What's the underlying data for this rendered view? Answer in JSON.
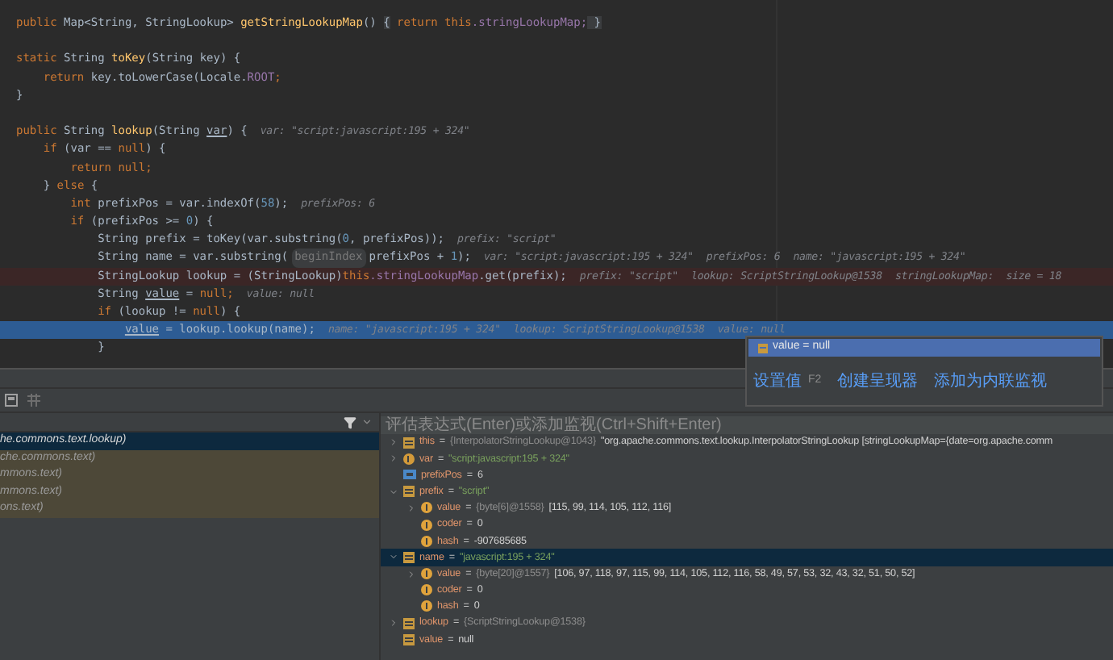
{
  "editor": {
    "lines": [
      {
        "segments": [
          {
            "kind": "kw",
            "text": "public "
          },
          {
            "kind": "plain",
            "text": "Map<String, StringLookup> "
          },
          {
            "kind": "method",
            "text": "getStringLookupMap"
          },
          {
            "kind": "plain",
            "text": "() "
          },
          {
            "kind": "fold",
            "text": "{"
          },
          {
            "kind": "kw",
            "text": " return this"
          },
          {
            "kind": "field",
            "text": ".stringLookupMap;"
          },
          {
            "kind": "fold",
            "text": " }"
          }
        ]
      },
      {
        "kind": "blank"
      },
      {
        "segments": [
          {
            "kind": "kw",
            "text": "static "
          },
          {
            "kind": "plain",
            "text": "String "
          },
          {
            "kind": "method",
            "text": "toKey"
          },
          {
            "kind": "plain",
            "text": "(String key) {"
          }
        ]
      },
      {
        "segments": [
          {
            "kind": "kw",
            "text": "    return "
          },
          {
            "kind": "plain",
            "text": "key.toLowerCase(Locale."
          },
          {
            "kind": "field",
            "text": "ROOT"
          },
          {
            "kind": "kw",
            "text": ";"
          }
        ]
      },
      {
        "segments": [
          {
            "kind": "plain",
            "text": "}"
          }
        ]
      },
      {
        "kind": "blank"
      },
      {
        "segments": [
          {
            "kind": "kw",
            "text": "public "
          },
          {
            "kind": "plain",
            "text": "String "
          },
          {
            "kind": "method",
            "text": "lookup"
          },
          {
            "kind": "plain",
            "text": "(String "
          },
          {
            "kind": "ul",
            "text": "var"
          },
          {
            "kind": "plain",
            "text": ") {"
          },
          {
            "kind": "hint",
            "text": "var: \"script:javascript:195 + 324\""
          }
        ]
      },
      {
        "segments": [
          {
            "kind": "kw",
            "text": "    if "
          },
          {
            "kind": "plain",
            "text": "(var == "
          },
          {
            "kind": "kw",
            "text": "null"
          },
          {
            "kind": "plain",
            "text": ") {"
          }
        ]
      },
      {
        "segments": [
          {
            "kind": "kw",
            "text": "        return null;"
          }
        ]
      },
      {
        "segments": [
          {
            "kind": "plain",
            "text": "    } "
          },
          {
            "kind": "kw",
            "text": "else "
          },
          {
            "kind": "plain",
            "text": "{"
          }
        ]
      },
      {
        "segments": [
          {
            "kind": "kw",
            "text": "        int "
          },
          {
            "kind": "plain",
            "text": "prefixPos = var.indexOf("
          },
          {
            "kind": "num",
            "text": "58"
          },
          {
            "kind": "plain",
            "text": ");"
          },
          {
            "kind": "hint",
            "text": "prefixPos: 6"
          }
        ]
      },
      {
        "segments": [
          {
            "kind": "kw",
            "text": "        if "
          },
          {
            "kind": "plain",
            "text": "(prefixPos >= "
          },
          {
            "kind": "num",
            "text": "0"
          },
          {
            "kind": "plain",
            "text": ") {"
          }
        ]
      },
      {
        "segments": [
          {
            "kind": "plain",
            "text": "            String prefix = toKey(var.substring("
          },
          {
            "kind": "num",
            "text": "0"
          },
          {
            "kind": "plain",
            "text": ", prefixPos));"
          },
          {
            "kind": "hint",
            "text": "prefix: \"script\""
          }
        ]
      },
      {
        "segments": [
          {
            "kind": "plain",
            "text": "            String name = var.substring("
          },
          {
            "kind": "param",
            "text": "beginIndex"
          },
          {
            "kind": "plain",
            "text": "prefixPos + "
          },
          {
            "kind": "num",
            "text": "1"
          },
          {
            "kind": "plain",
            "text": ");"
          },
          {
            "kind": "hint",
            "text": "var: \"script:javascript:195 + 324\""
          },
          {
            "kind": "hint",
            "text": "prefixPos: 6"
          },
          {
            "kind": "hint",
            "text": "name: \"javascript:195 + 324\""
          }
        ]
      },
      {
        "kind": "breakpoint",
        "segments": [
          {
            "kind": "plain",
            "text": "            StringLookup lookup = (StringLookup)"
          },
          {
            "kind": "kw",
            "text": "this"
          },
          {
            "kind": "field",
            "text": ".stringLookupMap"
          },
          {
            "kind": "plain",
            "text": ".get(prefix);"
          },
          {
            "kind": "hint",
            "text": "prefix: \"script\""
          },
          {
            "kind": "hint",
            "text": "lookup: ScriptStringLookup@1538"
          },
          {
            "kind": "hint",
            "text": "stringLookupMap:  size = 18"
          }
        ]
      },
      {
        "segments": [
          {
            "kind": "plain",
            "text": "            String "
          },
          {
            "kind": "ul",
            "text": "value"
          },
          {
            "kind": "plain",
            "text": " = "
          },
          {
            "kind": "kw",
            "text": "null;"
          },
          {
            "kind": "hint",
            "text": "value: null"
          }
        ]
      },
      {
        "segments": [
          {
            "kind": "kw",
            "text": "            if "
          },
          {
            "kind": "plain",
            "text": "(lookup != "
          },
          {
            "kind": "kw",
            "text": "null"
          },
          {
            "kind": "plain",
            "text": ") {"
          }
        ]
      },
      {
        "kind": "current",
        "segments": [
          {
            "kind": "ul",
            "text": "                value"
          },
          {
            "kind": "plain",
            "text": " = lookup.lookup(name);"
          },
          {
            "kind": "hint",
            "text": "name: \"javascript:195 + 324\""
          },
          {
            "kind": "hint",
            "text": "lookup: ScriptStringLookup@1538"
          },
          {
            "kind": "hint",
            "text": "value: null"
          }
        ]
      },
      {
        "segments": [
          {
            "kind": "plain",
            "text": "            }"
          }
        ]
      }
    ]
  },
  "popup": {
    "row": "value = null",
    "actions": [
      {
        "label": "设置值",
        "shortcut": "F2"
      },
      {
        "label": "创建呈现器"
      },
      {
        "label": "添加为内联监视"
      }
    ]
  },
  "frames": [
    {
      "text": "he.commons.text.lookup)",
      "selected": true,
      "library": false
    },
    {
      "text": "che.commons.text)",
      "selected": false,
      "library": true
    },
    {
      "text": "mmons.text)",
      "selected": false,
      "library": true
    },
    {
      "text": "mmons.text)",
      "selected": false,
      "library": true
    },
    {
      "text": "ons.text)",
      "selected": false,
      "library": true
    }
  ],
  "evaluate": {
    "placeholder": "评估表达式(Enter)或添加监视(Ctrl+Shift+Enter)"
  },
  "variables": [
    {
      "kind": "field",
      "name": "this",
      "op": "=",
      "type": "{InterpolatorStringLookup@1043}",
      "value": "\"org.apache.commons.text.lookup.InterpolatorStringLookup [stringLookupMap={date=org.apache.comm",
      "expanded": false,
      "selected": false
    },
    {
      "kind": "param",
      "name": "var",
      "op": "=",
      "string": "\"script:javascript:195 + 324\"",
      "expanded": false,
      "selected": false
    },
    {
      "kind": "primitive",
      "name": "prefixPos",
      "op": "=",
      "value": "6",
      "selected": false
    },
    {
      "kind": "field",
      "name": "prefix",
      "op": "=",
      "string": "\"script\"",
      "expanded": true,
      "selected": false,
      "children": [
        {
          "kind": "final",
          "name": "value",
          "op": "=",
          "type": "{byte[6]@1558}",
          "value": "[115, 99, 114, 105, 112, 116]",
          "expanded": false,
          "selected": false
        },
        {
          "kind": "final",
          "name": "coder",
          "op": "=",
          "value": "0",
          "selected": false
        },
        {
          "kind": "final",
          "name": "hash",
          "op": "=",
          "value": "-907685685",
          "selected": false
        }
      ]
    },
    {
      "kind": "field",
      "name": "name",
      "op": "=",
      "string": "\"javascript:195 + 324\"",
      "expanded": true,
      "selected": true,
      "children": [
        {
          "kind": "final",
          "name": "value",
          "op": "=",
          "type": "{byte[20]@1557}",
          "value": "[106, 97, 118, 97, 115, 99, 114, 105, 112, 116, 58, 49, 57, 53, 32, 43, 32, 51, 50, 52]",
          "expanded": false,
          "selected": false
        },
        {
          "kind": "final",
          "name": "coder",
          "op": "=",
          "value": "0",
          "selected": false
        },
        {
          "kind": "final",
          "name": "hash",
          "op": "=",
          "value": "0",
          "selected": false
        }
      ]
    },
    {
      "kind": "field",
      "name": "lookup",
      "op": "=",
      "type": "{ScriptStringLookup@1538}",
      "expanded": false,
      "selected": false
    },
    {
      "kind": "field",
      "name": "value",
      "op": "=",
      "value": "null",
      "selected": false
    }
  ]
}
